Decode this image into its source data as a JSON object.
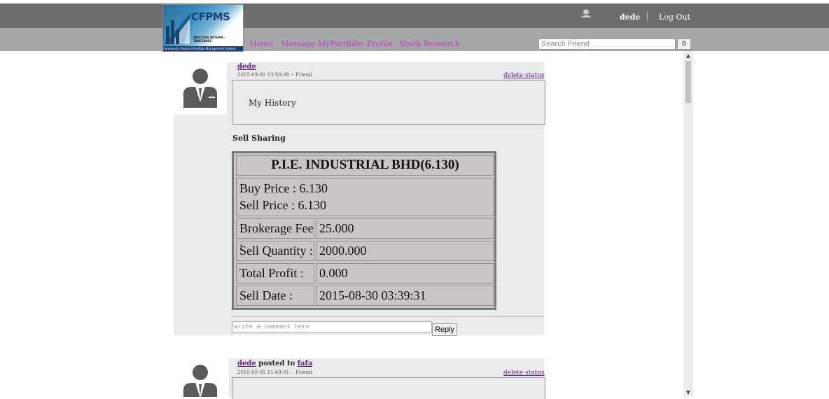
{
  "header": {
    "logo_text": "CFPMS",
    "logo_tagline": "PRECIOUS RETURN · TRACEABLE",
    "logo_footer": "Community Financial Portfolio Management System",
    "username": "dede",
    "logout": "Log Out"
  },
  "nav": {
    "items": [
      {
        "label": "Home"
      },
      {
        "label": "Message"
      },
      {
        "label": "MyPortfolio"
      },
      {
        "label": "Profile"
      },
      {
        "label": "Stock Research"
      }
    ],
    "search_placeholder": "Search Friend",
    "search_button": "0"
  },
  "posts": [
    {
      "author": "dede",
      "meta": "2015-09-01 13:50:08 -- Friend",
      "delete": "delete status",
      "status": "My History",
      "heading": "Sell Sharing",
      "share": {
        "title": "P.I.E. INDUSTRIAL BHD(6.130)",
        "buy_price": "Buy Price : 6.130",
        "sell_price": "Sell Price : 6.130",
        "rows": [
          {
            "label": "Brokerage Fee :",
            "value": "25.000"
          },
          {
            "label": "Sell Quantity :",
            "value": "2000.000"
          },
          {
            "label": "Total Profit :",
            "value": "0.000"
          },
          {
            "label": "Sell Date :",
            "value": "2015-08-30 03:39:31"
          }
        ]
      },
      "comment_placeholder": "write a comment here",
      "reply": "Reply"
    },
    {
      "author": "dede",
      "posted_to_text": "posted to",
      "target": "fafa",
      "meta": "2015-09-01 11:49:01 -- Friend",
      "delete": "delete status"
    }
  ],
  "colors": {
    "topbar": "#6d6d6d",
    "navbar": "#a6a6a6",
    "nav_link": "#c03cc9",
    "post_bg": "#e9eaec",
    "table_bg": "#cac4c5"
  }
}
